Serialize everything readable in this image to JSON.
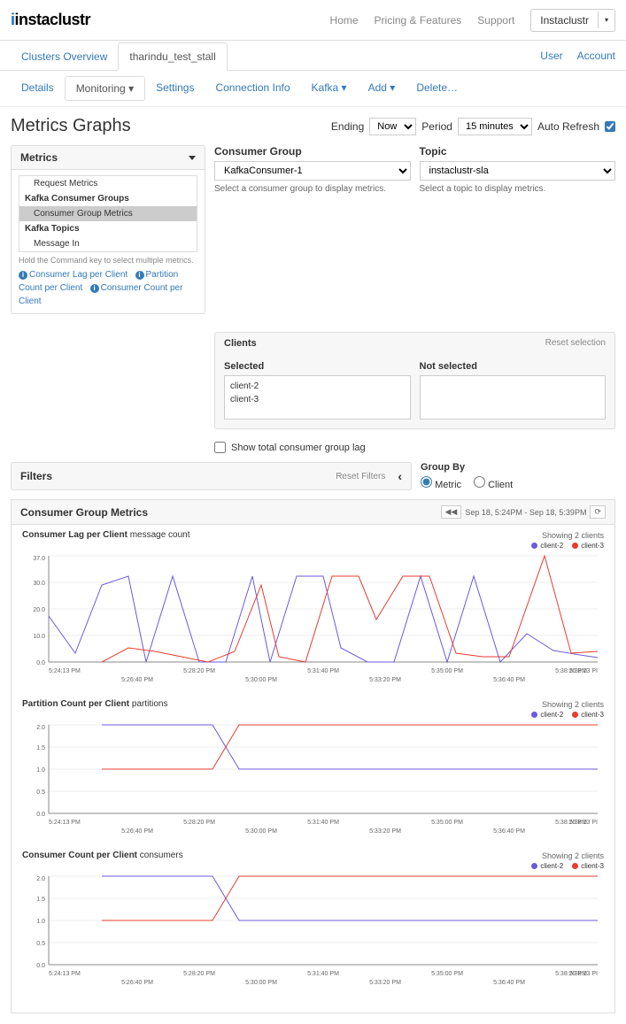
{
  "brand": "instaclustr",
  "topnav": {
    "home": "Home",
    "pricing": "Pricing & Features",
    "support": "Support",
    "account": "Instaclustr"
  },
  "tabs": {
    "overview": "Clusters Overview",
    "cluster": "tharindu_test_stall",
    "user": "User",
    "account": "Account"
  },
  "subtabs": {
    "details": "Details",
    "monitoring": "Monitoring",
    "settings": "Settings",
    "conninfo": "Connection Info",
    "kafka": "Kafka",
    "add": "Add",
    "delete": "Delete…"
  },
  "page_title": "Metrics Graphs",
  "controls": {
    "ending_label": "Ending",
    "ending_value": "Now",
    "period_label": "Period",
    "period_value": "15 minutes",
    "auto_refresh_label": "Auto Refresh"
  },
  "metrics_panel": {
    "title": "Metrics",
    "tree": {
      "request_metrics": "Request Metrics",
      "kafka_consumer_groups": "Kafka Consumer Groups",
      "consumer_group_metrics": "Consumer Group Metrics",
      "kafka_topics": "Kafka Topics",
      "message_in": "Message In"
    },
    "hint": "Hold the Command key to select multiple metrics.",
    "links": {
      "lag": "Consumer Lag per Client",
      "partition": "Partition Count per Client",
      "count": "Consumer Count per Client"
    }
  },
  "consumer_group": {
    "label": "Consumer Group",
    "value": "KafkaConsumer-1",
    "hint": "Select a consumer group to display metrics."
  },
  "topic": {
    "label": "Topic",
    "value": "instaclustr-sla",
    "hint": "Select a topic to display metrics."
  },
  "clients": {
    "title": "Clients",
    "reset": "Reset selection",
    "selected_label": "Selected",
    "not_selected_label": "Not selected",
    "selected": [
      "client-2",
      "client-3"
    ]
  },
  "total_lag_label": "Show total consumer group lag",
  "filters": {
    "title": "Filters",
    "reset": "Reset Filters"
  },
  "groupby": {
    "label": "Group By",
    "metric": "Metric",
    "client": "Client"
  },
  "section": {
    "title": "Consumer Group Metrics",
    "time_range": "Sep 18, 5:24PM - Sep 18, 5:39PM"
  },
  "charts": {
    "showing": "Showing 2 clients",
    "legend": {
      "c2": "client-2",
      "c3": "client-3"
    },
    "colors": {
      "c2": "#6b5bdd",
      "c3": "#e63c2e"
    },
    "xticks_major": [
      "5:24:13 PM",
      "5:28:20 PM",
      "5:31:40 PM",
      "5:35:00 PM",
      "5:38:20 PM",
      "5:38:13 PI"
    ],
    "xticks_minor": [
      "5:26:40 PM",
      "5:30:00 PM",
      "5:33:20 PM",
      "5:36:40 PM"
    ],
    "lag": {
      "title_bold": "Consumer Lag per Client",
      "title_note": "message count",
      "yticks": [
        "0.0",
        "10.0",
        "20.0",
        "30.0",
        "37.0"
      ]
    },
    "partition": {
      "title_bold": "Partition Count per Client",
      "title_note": "partitions",
      "yticks": [
        "0.0",
        "0.5",
        "1.0",
        "1.5",
        "2.0"
      ]
    },
    "count": {
      "title_bold": "Consumer Count per Client",
      "title_note": "consumers",
      "yticks": [
        "0.0",
        "0.5",
        "1.0",
        "1.5",
        "2.0"
      ]
    }
  },
  "chart_data": [
    {
      "type": "line",
      "title": "Consumer Lag per Client (message count)",
      "xlabel": "",
      "ylabel": "message count",
      "ylim": [
        0,
        37
      ],
      "x": [
        "5:24:13",
        "5:25:00",
        "5:26:00",
        "5:26:40",
        "5:27:30",
        "5:28:20",
        "5:29:00",
        "5:30:00",
        "5:30:30",
        "5:31:00",
        "5:31:40",
        "5:32:30",
        "5:33:20",
        "5:34:00",
        "5:35:00",
        "5:35:30",
        "5:36:00",
        "5:36:40",
        "5:37:20",
        "5:38:00",
        "5:38:20"
      ],
      "series": [
        {
          "name": "client-2",
          "values": [
            16,
            3,
            27,
            30,
            0,
            30,
            0,
            0,
            30,
            0,
            30,
            30,
            5,
            0,
            0,
            30,
            0,
            30,
            0,
            10,
            4
          ]
        },
        {
          "name": "client-3",
          "values": [
            null,
            null,
            0,
            5,
            4,
            2,
            0,
            4,
            27,
            2,
            0,
            30,
            30,
            15,
            30,
            30,
            3,
            2,
            2,
            37,
            3
          ]
        }
      ]
    },
    {
      "type": "line",
      "title": "Partition Count per Client (partitions)",
      "xlabel": "",
      "ylabel": "partitions",
      "ylim": [
        0,
        2
      ],
      "x": [
        "5:24:13",
        "5:26:40",
        "5:28:00",
        "5:28:40",
        "5:29:20",
        "5:31:40",
        "5:35:00",
        "5:38:20"
      ],
      "series": [
        {
          "name": "client-2",
          "values": [
            null,
            2,
            2,
            1.5,
            1,
            1,
            1,
            1
          ]
        },
        {
          "name": "client-3",
          "values": [
            null,
            1,
            1,
            1.5,
            2,
            2,
            2,
            2
          ]
        }
      ]
    },
    {
      "type": "line",
      "title": "Consumer Count per Client (consumers)",
      "xlabel": "",
      "ylabel": "consumers",
      "ylim": [
        0,
        2
      ],
      "x": [
        "5:24:13",
        "5:26:40",
        "5:28:00",
        "5:28:40",
        "5:29:20",
        "5:31:40",
        "5:35:00",
        "5:38:20"
      ],
      "series": [
        {
          "name": "client-2",
          "values": [
            null,
            2,
            2,
            1.5,
            1,
            1,
            1,
            1
          ]
        },
        {
          "name": "client-3",
          "values": [
            null,
            1,
            1,
            1.5,
            2,
            2,
            2,
            2
          ]
        }
      ]
    }
  ]
}
